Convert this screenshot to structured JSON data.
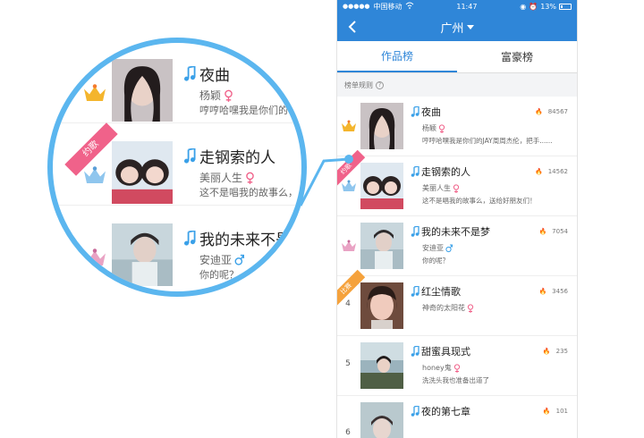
{
  "statusbar": {
    "carrier": "中国移动",
    "time": "11:47",
    "battery": "13%"
  },
  "navbar": {
    "city": "广州"
  },
  "tabs": [
    {
      "label": "作品榜",
      "active": true
    },
    {
      "label": "富豪榜",
      "active": false
    }
  ],
  "rule": {
    "label": "榜单规则",
    "icon": "?"
  },
  "rows": [
    {
      "song": "夜曲",
      "singer": "杨颖",
      "gender": "female",
      "comment": "哼哼哈嘿我是你们的JAY周周杰伦，把手......",
      "hot": "84567",
      "rank_icon": "gold-crown"
    },
    {
      "song": "走钢索的人",
      "singer": "美丽人生",
      "gender": "female",
      "comment": "这不是唱我的故事么，送给好朋友们！",
      "hot": "14562",
      "rank_icon": "silver-crown",
      "ribbon": "约歌"
    },
    {
      "song": "我的未来不是梦",
      "singer": "安迪亚",
      "gender": "male",
      "comment": "你的呢？",
      "hot": "7054",
      "rank_icon": "bronze-crown"
    },
    {
      "song": "红尘情歌",
      "singer": "神奇的太阳花",
      "gender": "female",
      "comment": "",
      "hot": "3456",
      "rank": "4",
      "ribbon": "比赛"
    },
    {
      "song": "甜蜜具现式",
      "singer": "honey鬼",
      "gender": "female",
      "comment": "洗洗头我也准备出道了",
      "hot": "235",
      "rank": "5"
    },
    {
      "song": "夜的第七章",
      "singer": "",
      "gender": "",
      "comment": "",
      "hot": "101",
      "rank": "6"
    }
  ],
  "magnified": [
    {
      "song": "夜曲",
      "singer": "杨颖",
      "comment": "哼哼哈嘿我是你们的"
    },
    {
      "song": "走钢索的人",
      "singer": "美丽人生",
      "comment": "这不是唱我的故事么，",
      "ribbon": "约歌"
    },
    {
      "song": "我的未来不是",
      "singer": "安迪亚",
      "comment": "你的呢？"
    }
  ],
  "colors": {
    "primary": "#2f86d8",
    "magnifier_ring": "#5bb6ef",
    "female": "#f0628a",
    "male": "#3aa0e8",
    "ribbon_pink": "#f0628a",
    "ribbon_orange": "#f5a23c"
  }
}
